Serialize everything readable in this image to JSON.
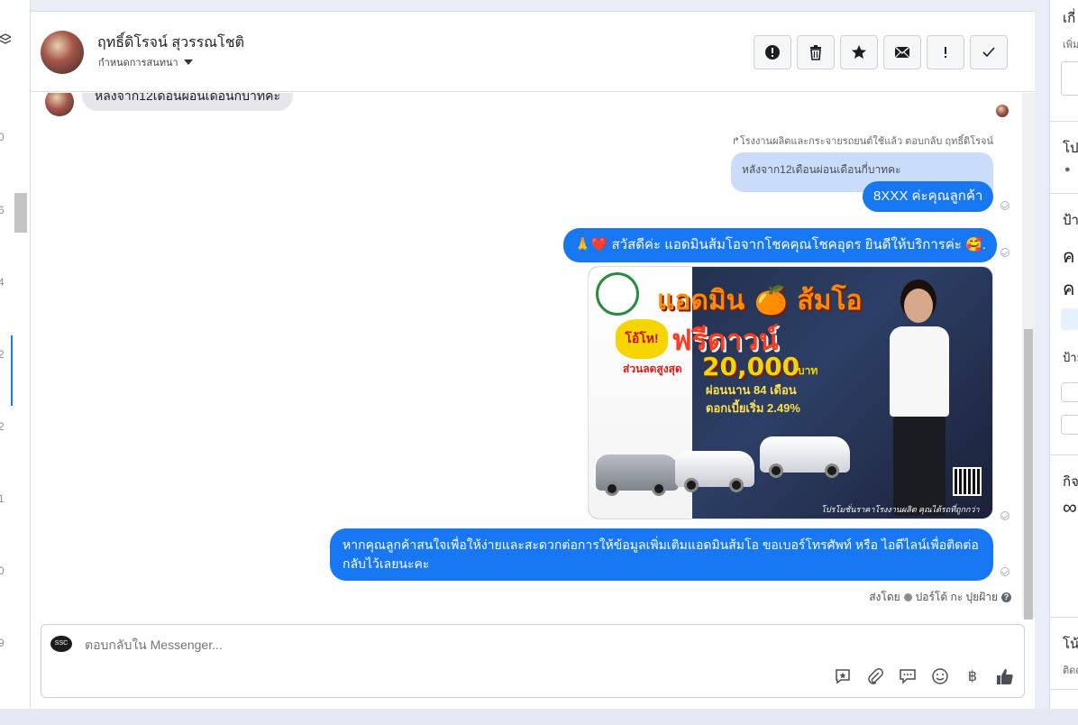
{
  "left_rail": {
    "numbers": [
      "0",
      "6",
      "4",
      "2",
      "2",
      "1",
      "0",
      "9"
    ]
  },
  "header": {
    "contact_name": "ฤทธิ์ดิโรจน์ สุวรรณโชติ",
    "subtitle": "กำหนดการสนทนา",
    "actions": [
      {
        "name": "spam-icon"
      },
      {
        "name": "trash-icon"
      },
      {
        "name": "star-icon"
      },
      {
        "name": "envelope-icon"
      },
      {
        "name": "alert-icon"
      },
      {
        "name": "check-icon"
      }
    ]
  },
  "messages": {
    "incoming_text": "หลังจาก12เดือนผ่อนเดือนกี่บาทคะ",
    "reply_context": "↱โรงงานผลิตและกระจายรถยนต์ใช้แล้ว ตอบกลับ ฤทธิ์ดิโรจน์",
    "quoted_text": "หลังจาก12เดือนผ่อนเดือนกี่บาทคะ",
    "reply_1": "8XXX ค่ะคุณลูกค้า",
    "reply_2": "🙏❤️ สวัสดีค่ะ แอดมินส้มโอจากโชคคุณโชคอุดร ยินดีให้บริการค่ะ 🥰.",
    "promo": {
      "headline": "แอดมิน 🍊 ส้มโอ",
      "burst": "โอ้โห!",
      "free_text": "ฟรีดาวน์",
      "discount_label": "ส่วนลดสูงสุด",
      "amount": "20,000",
      "currency": "บาท",
      "months": "ผ่อนนาน 84 เดือน",
      "rate": "ดอกเบี้ยเริ่ม 2.49%",
      "footer": "โปรโมชั่นราคาโรงงานผลิต คุณได้รถที่ถูกกว่า"
    },
    "reply_3": "หากคุณลูกค้าสนใจเพื่อให้ง่ายและสะดวกต่อการให้ข้อมูลเพิ่มเติมแอดมินส้มโอ ขอเบอร์โทรศัพท์ หรือ ไอดีไลน์เพื่อติดต่อกลับไว้เลยนะคะ",
    "sent_by_label": "ส่งโดย",
    "sent_by_name": "ปอร์โต้ กะ ปุยฝ้าย",
    "help": "?"
  },
  "composer": {
    "placeholder": "ตอบกลับใน Messenger...",
    "avatar_text": "SSC",
    "tools": [
      {
        "name": "saved-reply-icon"
      },
      {
        "name": "attachment-icon"
      },
      {
        "name": "chat-bubbles-icon"
      },
      {
        "name": "emoji-icon"
      },
      {
        "name": "baht-icon",
        "glyph": "฿"
      },
      {
        "name": "thumbs-up-icon"
      }
    ]
  },
  "right_panel": {
    "t1": "เกี่",
    "t2": "เพิ่ม",
    "t3": "โป",
    "t4": "ป้า",
    "t5": "ค",
    "t6": "ค",
    "t7": "ป้าย",
    "t8": "กิจ",
    "t9": "∞",
    "t10": "โน้",
    "t11": "ติดต"
  },
  "colors": {
    "accent": "#1877f2",
    "quoted_bg": "#c9dcf9",
    "incoming_bg": "#e4e6eb"
  }
}
